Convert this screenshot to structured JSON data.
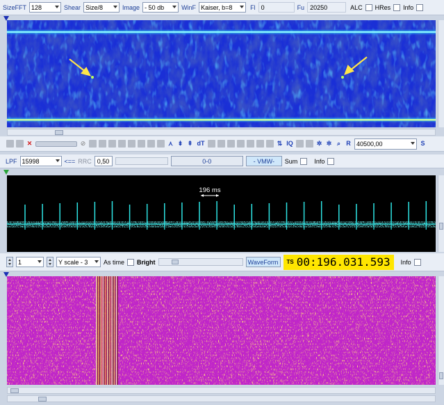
{
  "spectrum_toolbar": {
    "sizefft_label": "SizeFFT",
    "sizefft_value": "128",
    "shear_label": "Shear",
    "shear_value": "Size/8",
    "image_label": "Image",
    "image_value": "- 50 db",
    "winf_label": "WinF",
    "winf_value": "Kaiser, b=8",
    "fl_label": "Fl",
    "fl_value": "0",
    "fu_label": "Fu",
    "fu_value": "20250",
    "alc_label": "ALC",
    "hres_label": "HRes",
    "info_label": "Info"
  },
  "spectrum_tools": {
    "frequency_value": "40500,00",
    "icons": [
      "record-icon",
      "stop-icon",
      "delete-icon",
      "slider-icon",
      "no-icon",
      "square-icon",
      "square-icon",
      "gray-icon",
      "gray-icon",
      "gray-icon",
      "gray-icon",
      "gray-icon",
      "gray-icon",
      "spread-icon",
      "arrows-up-icon",
      "arrows-down-icon",
      "dt-icon",
      "gray-icon",
      "gray-icon",
      "gray-icon",
      "gray-icon",
      "gray-icon",
      "gray-icon",
      "gray-icon",
      "iq-sort-icon",
      "iq-icon",
      "gray-icon",
      "gray-icon",
      "settings-icon",
      "settings-icon",
      "search-icon",
      "r-icon"
    ],
    "dt_label": "dT",
    "iq_label": "IQ",
    "r_label": "R",
    "s_label": "S"
  },
  "filter_toolbar": {
    "lpf_label": "LPF",
    "lpf_value": "15998",
    "arrow_label": "<==",
    "rrc_label": "RRC",
    "rrc_value": "0,50",
    "range_value": "0-0",
    "vmw_label": "- VMW-",
    "sum_label": "Sum",
    "info_label": "Info"
  },
  "waveform": {
    "annotation": "196 ms",
    "pulse_count": 24,
    "color": "#2ee6e6"
  },
  "bit_toolbar": {
    "step_value": "1",
    "yscale_value": "Y scale - 3",
    "astime_label": "As time",
    "bright_label": "Bright",
    "waveform_button": "WaveForm",
    "ts_tag": "TS",
    "ts_value": "00:196.031.593",
    "info_label": "Info"
  },
  "colors": {
    "spectrum_bg": "#1a2fd6",
    "spectrum_line": "#3ef0ff",
    "arrow": "#ffe64a",
    "pattern_magenta": "#c026c9",
    "pattern_orange": "#f2a24a"
  }
}
